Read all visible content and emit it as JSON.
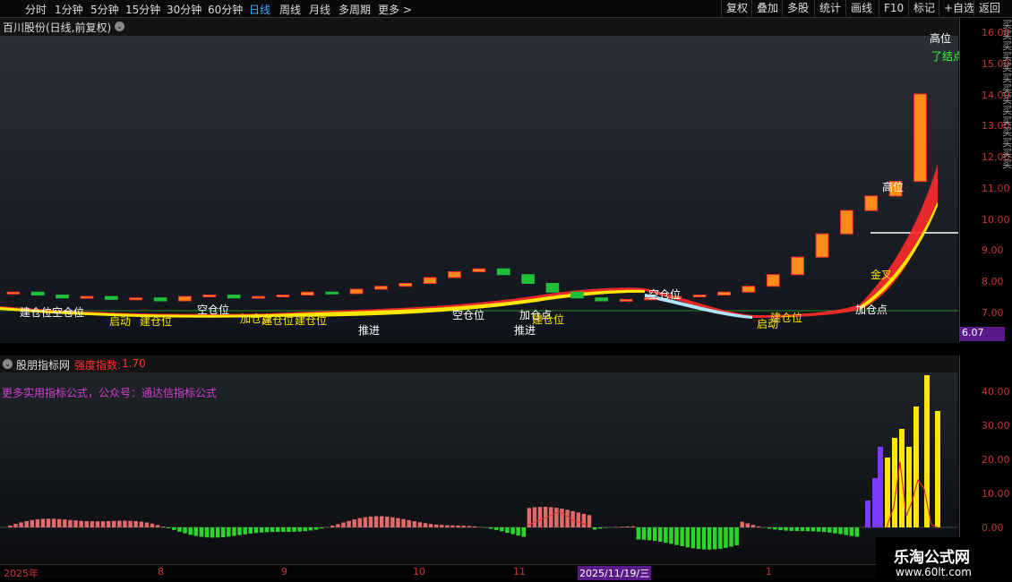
{
  "periods": [
    "分时",
    "1分钟",
    "5分钟",
    "15分钟",
    "30分钟",
    "60分钟",
    "日线",
    "周线",
    "月线",
    "多周期",
    "更多 >"
  ],
  "toolbar": [
    "复权",
    "叠加",
    "多股",
    "统计",
    "画线",
    "F10",
    "标记",
    "+自选",
    "返回"
  ],
  "title": "百川股份(日线,前复权)",
  "yaxis_main": [
    "16.00",
    "15.00",
    "14.00",
    "13.00",
    "12.00",
    "11.00",
    "10.00",
    "9.00",
    "8.00",
    "7.00"
  ],
  "current_price": "6.07",
  "sub": {
    "name": "股朋指标网",
    "strength_label": "强度指数:",
    "strength_value": "1.70",
    "promo": "更多实用指标公式，公众号：通达信指标公式"
  },
  "yaxis_sub": [
    "40.00",
    "30.00",
    "20.00",
    "10.00",
    "0.00"
  ],
  "dates": [
    "2025年",
    "8",
    "9",
    "10",
    "11",
    "2025/11/19/三",
    "1"
  ],
  "labels_main": [
    "建仓位",
    "空仓位",
    "启动",
    "建仓位",
    "空仓位",
    "加仓点",
    "建仓位",
    "建仓位",
    "推进",
    "空仓位",
    "加仓点",
    "建仓位",
    "推进",
    "空仓位",
    "启动",
    "建仓位",
    "加仓点",
    "金叉",
    "高位",
    "高位",
    "了结点"
  ],
  "watermark": {
    "title": "乐淘公式网",
    "url": "www.60lt.com"
  },
  "side_text": "买买买买买买买买买买买买买买",
  "chart_data": {
    "type": "candlestick",
    "xlabel": "",
    "ylabel": "",
    "ylim": [
      6.07,
      16.0
    ],
    "closes": [
      7.2,
      7.1,
      7.0,
      7.05,
      6.95,
      7.0,
      6.9,
      7.05,
      7.1,
      7.0,
      7.05,
      7.1,
      7.2,
      7.15,
      7.3,
      7.4,
      7.5,
      7.7,
      7.9,
      8.0,
      7.8,
      7.5,
      7.2,
      7.0,
      6.9,
      6.95,
      7.0,
      7.05,
      7.1,
      7.2,
      7.4,
      7.8,
      8.4,
      9.2,
      10.0,
      10.5,
      11.0,
      14.0
    ]
  }
}
